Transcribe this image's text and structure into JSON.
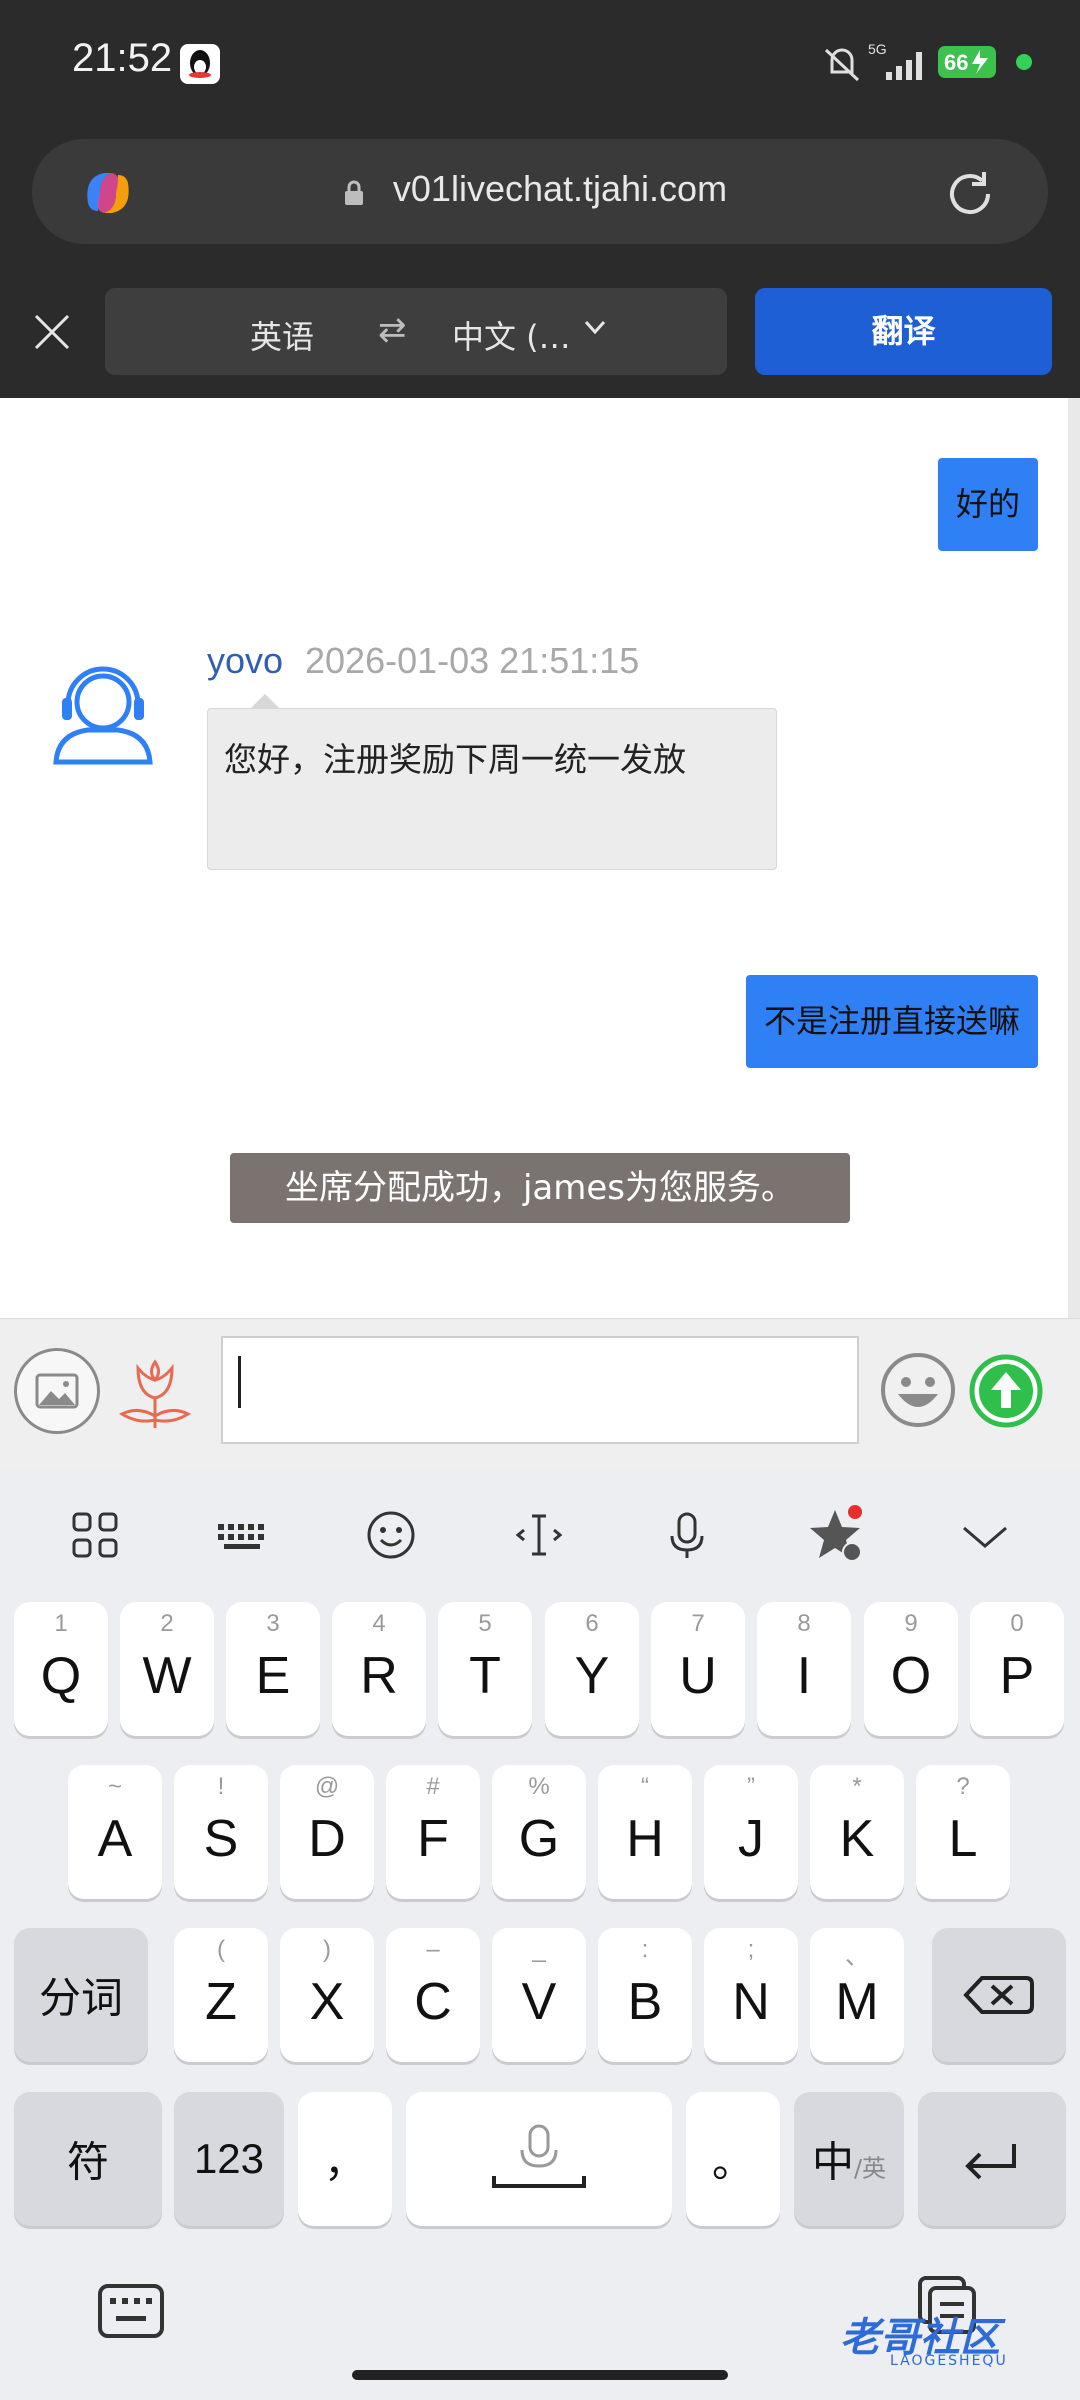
{
  "status_bar": {
    "time": "21:52",
    "network": "5G",
    "battery": "66"
  },
  "browser": {
    "url": "v01livechat.tjahi.com"
  },
  "translate_bar": {
    "source_lang": "英语",
    "target_lang": "中文 (…",
    "translate_label": "翻译"
  },
  "chat": {
    "messages": [
      {
        "from": "me",
        "text": "好的"
      },
      {
        "from": "agent",
        "name": "yovo",
        "time": "2026-01-03 21:51:15",
        "text": "您好，注册奖励下周一统一发放"
      },
      {
        "from": "me",
        "text": "不是注册直接送嘛"
      }
    ],
    "system_message": "坐席分配成功，james为您服务。"
  },
  "input": {
    "value": ""
  },
  "keyboard": {
    "row1": [
      {
        "k": "Q",
        "s": "1"
      },
      {
        "k": "W",
        "s": "2"
      },
      {
        "k": "E",
        "s": "3"
      },
      {
        "k": "R",
        "s": "4"
      },
      {
        "k": "T",
        "s": "5"
      },
      {
        "k": "Y",
        "s": "6"
      },
      {
        "k": "U",
        "s": "7"
      },
      {
        "k": "I",
        "s": "8"
      },
      {
        "k": "O",
        "s": "9"
      },
      {
        "k": "P",
        "s": "0"
      }
    ],
    "row2": [
      {
        "k": "A",
        "s": "~"
      },
      {
        "k": "S",
        "s": "!"
      },
      {
        "k": "D",
        "s": "@"
      },
      {
        "k": "F",
        "s": "#"
      },
      {
        "k": "G",
        "s": "%"
      },
      {
        "k": "H",
        "s": "“"
      },
      {
        "k": "J",
        "s": "”"
      },
      {
        "k": "K",
        "s": "*"
      },
      {
        "k": "L",
        "s": "?"
      }
    ],
    "row3": [
      {
        "k": "Z",
        "s": "("
      },
      {
        "k": "X",
        "s": ")"
      },
      {
        "k": "C",
        "s": "–"
      },
      {
        "k": "V",
        "s": "_"
      },
      {
        "k": "B",
        "s": ":"
      },
      {
        "k": "N",
        "s": ";"
      },
      {
        "k": "M",
        "s": "、"
      }
    ],
    "fenci": "分词",
    "fu": "符",
    "num": "123",
    "comma": "，",
    "period": "。",
    "zhong": "中",
    "ying": "/英"
  },
  "watermark": {
    "text": "老哥社区",
    "sub": "LAOGESHEQU"
  }
}
